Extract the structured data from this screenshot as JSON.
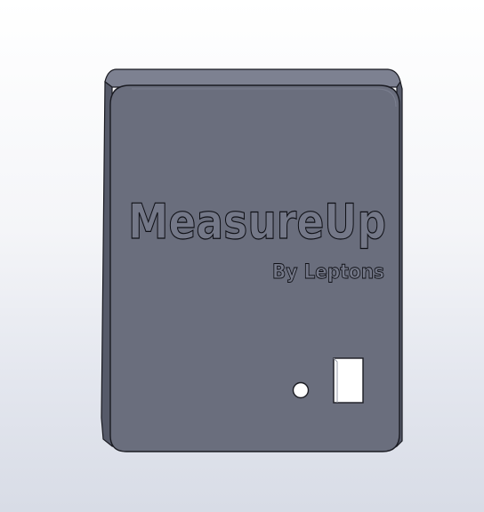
{
  "model": {
    "title": "MeasureUp",
    "subtitle": "By Leptons"
  },
  "colors": {
    "body_face": "#6a6e7d",
    "body_side": "#565a69",
    "body_top": "#7d8191",
    "edge": "#1a1b22",
    "hole": "#ffffff",
    "text_relief": "#747888"
  },
  "icons": {
    "round_port": "circle-hole-icon",
    "square_port": "rectangular-slot-icon"
  }
}
